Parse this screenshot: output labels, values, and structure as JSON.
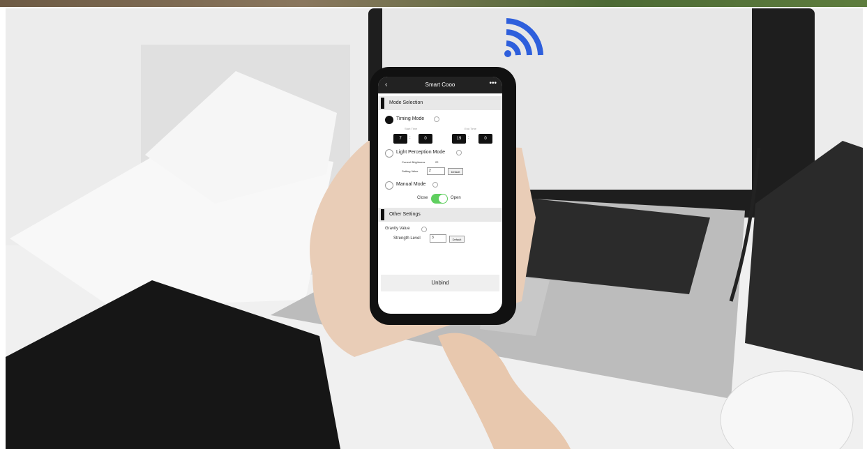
{
  "app": {
    "title": "Smart Cooo",
    "back_label": "‹",
    "more_label": "•••"
  },
  "sections": {
    "mode_selection": "Mode Selection",
    "other_settings": "Other Settings"
  },
  "timing": {
    "label": "Timing Mode",
    "start_label": "Start Time",
    "end_label": "End Time",
    "start_hour": "7",
    "start_min": "0",
    "end_hour": "19",
    "end_min": "0",
    "selected": true
  },
  "light": {
    "label": "Light Perception Mode",
    "current_brightness_label": "Current Brightness",
    "current_brightness_value": "22",
    "setting_label": "Setting Value",
    "setting_value": "2",
    "default_label": "Default",
    "selected": false
  },
  "manual": {
    "label": "Manual Mode",
    "close_label": "Close",
    "open_label": "Open",
    "is_open": true,
    "selected": false
  },
  "gravity": {
    "label": "Gravity Value",
    "strength_label": "Strength Level",
    "strength_value": "3",
    "default_label": "Default"
  },
  "actions": {
    "unbind_label": "Unbind"
  },
  "colors": {
    "wifi_blue": "#2e5fdc",
    "toggle_on": "#5fcf5f"
  }
}
